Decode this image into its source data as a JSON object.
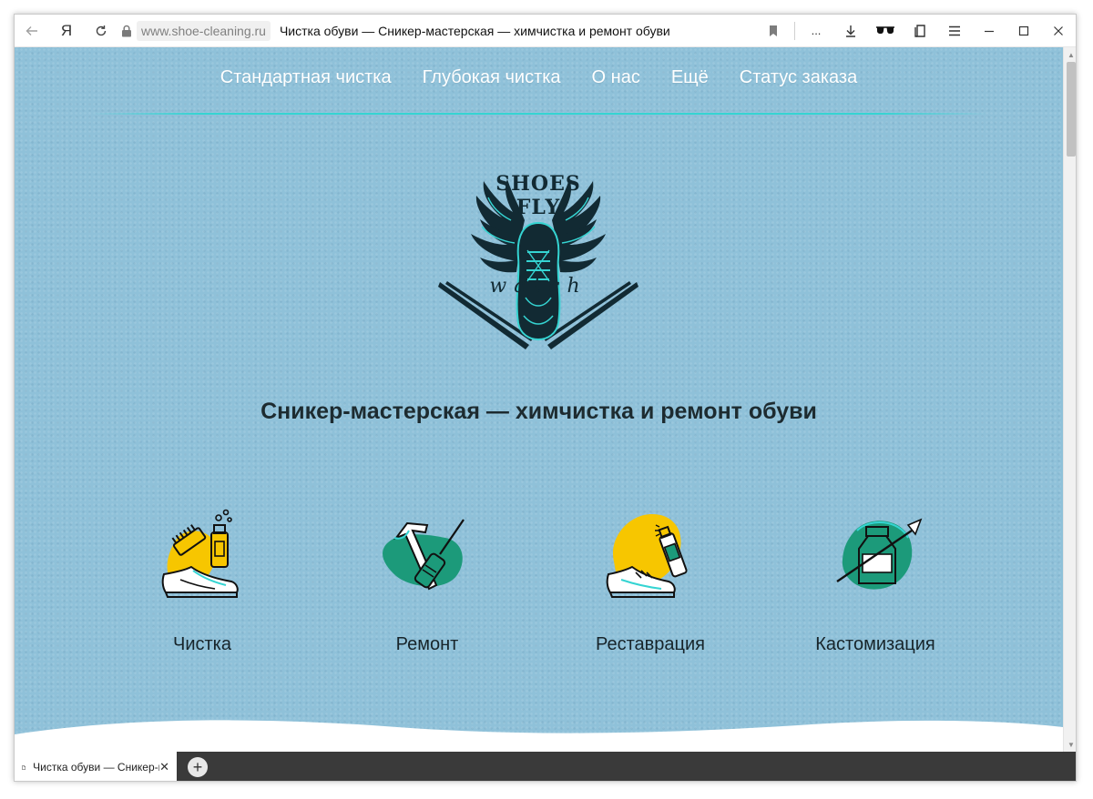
{
  "browser": {
    "url": "www.shoe-cleaning.ru",
    "page_title": "Чистка обуви — Сникер-мастерская — химчистка и ремонт обуви",
    "more_label": "...",
    "yandex_label": "Я"
  },
  "nav": {
    "items": [
      {
        "label": "Стандартная чистка"
      },
      {
        "label": "Глубокая чистка"
      },
      {
        "label": "О нас"
      },
      {
        "label": "Ещё"
      },
      {
        "label": "Статус заказа"
      }
    ]
  },
  "logo": {
    "line1": "SHOES",
    "line2": "FLY",
    "line3": "watch"
  },
  "headline": "Сникер-мастерская — химчистка и ремонт обуви",
  "services": [
    {
      "label": "Чистка",
      "icon": "sneaker-cleaning-icon"
    },
    {
      "label": "Ремонт",
      "icon": "repair-tools-icon"
    },
    {
      "label": "Реставрация",
      "icon": "sneaker-spray-icon"
    },
    {
      "label": "Кастомизация",
      "icon": "paint-brush-icon"
    }
  ],
  "tab": {
    "title": "Чистка обуви — Сникер-мастерская — химчистка и ремонт обуви"
  },
  "colors": {
    "page_background": "#8fc1d9",
    "accent_teal": "#35d4d2",
    "blob_yellow": "#f7c600",
    "blob_green": "#1c9a7a",
    "text_dark": "#1d2b30",
    "tabbar": "#3a3a3a"
  }
}
